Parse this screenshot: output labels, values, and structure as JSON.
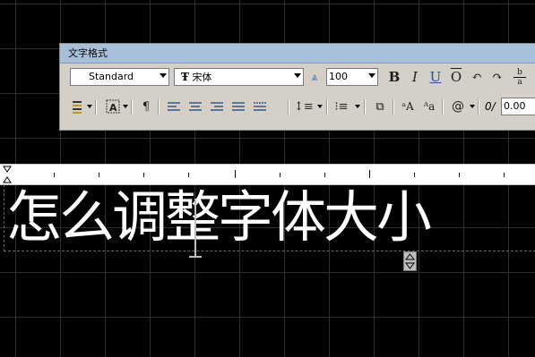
{
  "window": {
    "title": "文字格式"
  },
  "toolbar": {
    "style_select": {
      "value": "Standard"
    },
    "font_select": {
      "value": "宋体",
      "prefix_icon": "truetype-icon"
    },
    "annotative_icon": "annotative-icon",
    "height_select": {
      "value": "100"
    },
    "bold_label": "B",
    "italic_label": "I",
    "underline_label": "U",
    "overline_label": "O",
    "stack_label_top": "b",
    "stack_label_bottom": "a",
    "oblique_prefix": "0/",
    "oblique_value": "0.00"
  },
  "editor": {
    "text": "怎么调整字体大小"
  },
  "colors": {
    "toolbar_bg": "#d4d0c8",
    "title_bar": "#a7bfd9",
    "canvas_bg": "#000000",
    "grid": "#2a2e35"
  }
}
